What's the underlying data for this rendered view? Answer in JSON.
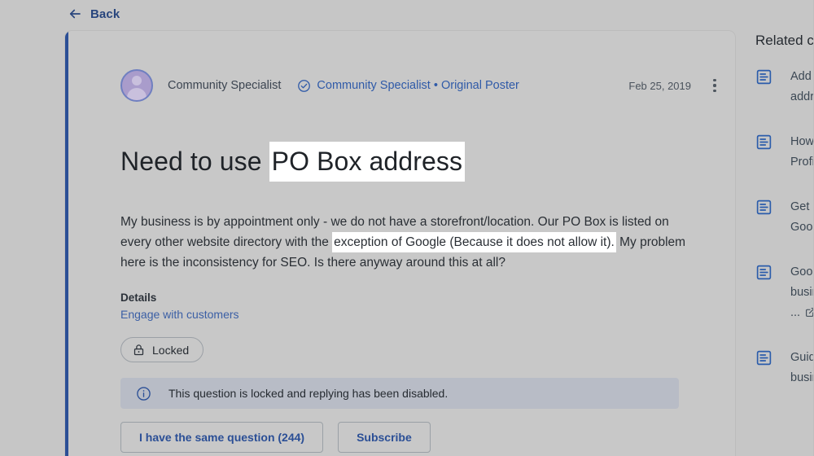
{
  "nav": {
    "back_label": "Back",
    "back_icon": "arrow-left-icon"
  },
  "post": {
    "author_name": "Community Specialist",
    "verified_icon": "check-circle-icon",
    "author_badge": "Community Specialist • Original Poster",
    "date": "Feb 25, 2019",
    "more_icon": "kebab-menu-icon",
    "title_plain": "Need to use ",
    "title_highlight": "PO Box address",
    "body_part1": "My business is by appointment only - we do not have a storefront/location.  Our PO Box is listed on every other website directory with the ",
    "body_highlight": "exception of Google (Because it does not allow it).",
    "body_part2": "  My problem here is the inconsistency for SEO.  Is there anyway around this at all?",
    "details_label": "Details",
    "details_link": "Engage with customers",
    "locked_chip_label": "Locked",
    "locked_chip_icon": "lock-icon",
    "banner_icon": "info-circle-icon",
    "banner_text": "This question is locked and replying has been disabled.",
    "same_question_button": "I have the same question (244)",
    "subscribe_button": "Subscribe"
  },
  "sidebar": {
    "title": "Related c",
    "items": [
      {
        "icon": "article-icon",
        "line1": "Add",
        "line2": "addr",
        "external": false
      },
      {
        "icon": "article-icon",
        "line1": "How",
        "line2": "Profi",
        "external": false
      },
      {
        "icon": "article-icon",
        "line1": "Get ",
        "line2": "Goog",
        "external": false
      },
      {
        "icon": "article-icon",
        "line1": "Goog",
        "line2": "busin",
        "line3": "...",
        "external": true
      },
      {
        "icon": "article-icon",
        "line1": "Guid",
        "line2": "busin",
        "external": false
      }
    ]
  },
  "colors": {
    "page_background": "#c6c6c6",
    "card_background": "#c8c8c8",
    "accent_bar": "#2b4f96",
    "link_blue": "#2b4f96",
    "highlight": "#ffffff",
    "banner_background": "#b8bcc6",
    "avatar": "#a99ccb"
  }
}
